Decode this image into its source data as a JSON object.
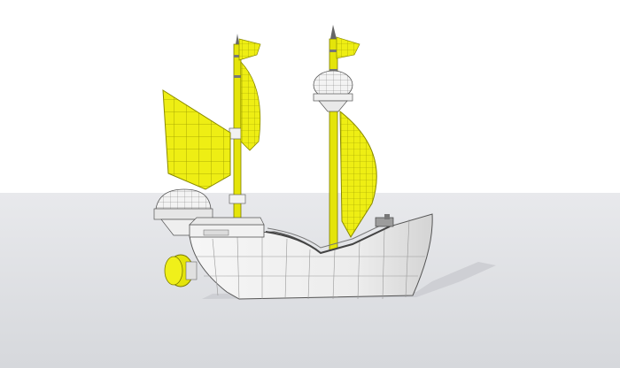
{
  "scene": {
    "subject": "ship-wireframe-render",
    "colors": {
      "sky": "#ffffff",
      "ground": "#dcdee2",
      "ground_far": "#e7e8eb",
      "hull": "#f2f2f2",
      "hull_shade": "#d9d9d9",
      "wire": "#6b6b6b",
      "sail_yellow": "#ecec10",
      "sail_yellow_dark": "#c9c900",
      "shadow": "#c4c6cb"
    }
  }
}
